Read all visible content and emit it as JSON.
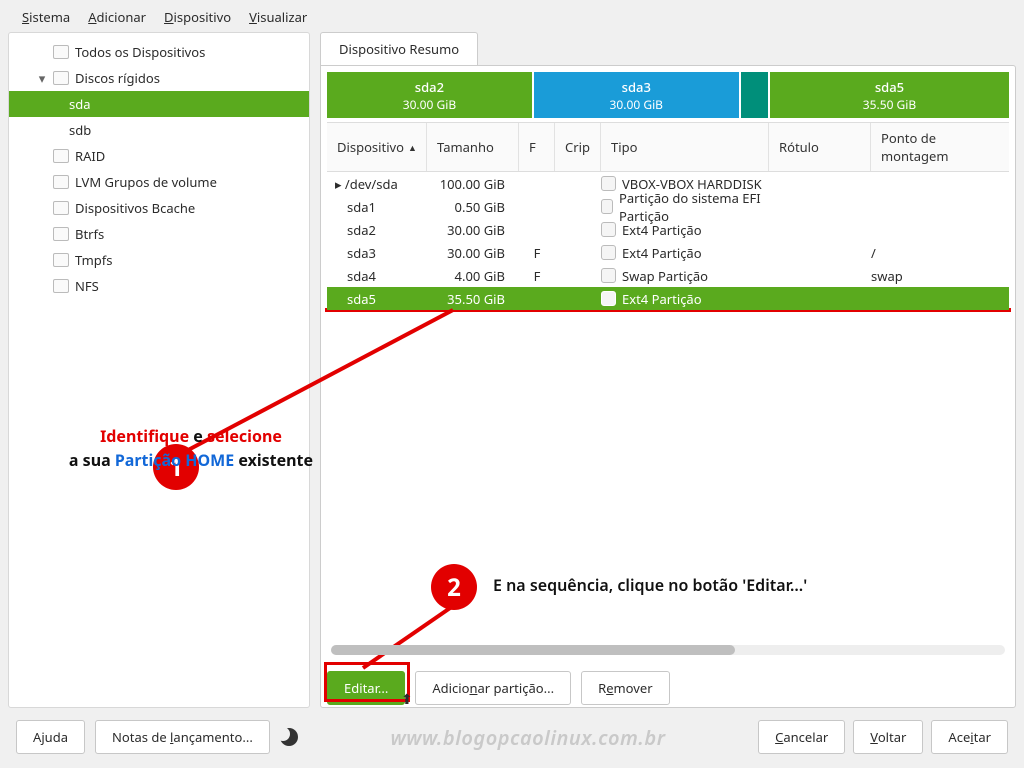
{
  "menu": {
    "sistema": "Sistema",
    "adicionar": "Adicionar",
    "dispositivo": "Dispositivo",
    "visualizar": "Visualizar"
  },
  "sidebar": {
    "allDevices": "Todos os Dispositivos",
    "hardDisks": "Discos rígidos",
    "sda": "sda",
    "sdb": "sdb",
    "raid": "RAID",
    "lvm": "LVM Grupos de volume",
    "bcache": "Dispositivos Bcache",
    "btrfs": "Btrfs",
    "tmpfs": "Tmpfs",
    "nfs": "NFS"
  },
  "tab": "Dispositivo Resumo",
  "partbar": {
    "sda2": {
      "name": "sda2",
      "size": "30.00 GiB"
    },
    "sda3": {
      "name": "sda3",
      "size": "30.00 GiB"
    },
    "sda5": {
      "name": "sda5",
      "size": "35.50 GiB"
    }
  },
  "cols": {
    "device": "Dispositivo",
    "size": "Tamanho",
    "f": "F",
    "crip": "Crip",
    "type": "Tipo",
    "label": "Rótulo",
    "mount": "Ponto de montagem"
  },
  "rows": [
    {
      "dev": "/dev/sda",
      "size": "100.00 GiB",
      "f": "",
      "type": "VBOX-VBOX HARDDISK",
      "mount": ""
    },
    {
      "dev": "sda1",
      "size": "0.50 GiB",
      "f": "",
      "type": "Partição do sistema EFI Partição",
      "mount": ""
    },
    {
      "dev": "sda2",
      "size": "30.00 GiB",
      "f": "",
      "type": "Ext4 Partição",
      "mount": ""
    },
    {
      "dev": "sda3",
      "size": "30.00 GiB",
      "f": "F",
      "type": "Ext4 Partição",
      "mount": "/"
    },
    {
      "dev": "sda4",
      "size": "4.00 GiB",
      "f": "F",
      "type": "Swap Partição",
      "mount": "swap"
    },
    {
      "dev": "sda5",
      "size": "35.50 GiB",
      "f": "",
      "type": "Ext4 Partição",
      "mount": ""
    }
  ],
  "buttons": {
    "edit": "Editar...",
    "add": "Adicionar partição...",
    "remove": "Remover"
  },
  "footer": {
    "help": "Ajuda",
    "notes": "Notas de lançamento...",
    "cancel": "Cancelar",
    "back": "Voltar",
    "accept": "Aceitar"
  },
  "watermark": "www.blogopcaolinux.com.br",
  "ann": {
    "line1a": "Identifique",
    "line1b": " e ",
    "line1c": "selecione",
    "line2a": "a sua ",
    "line2b": "Partição HOME",
    "line2c": " existente",
    "step2": "E na sequência, clique no botão 'Editar...'"
  }
}
